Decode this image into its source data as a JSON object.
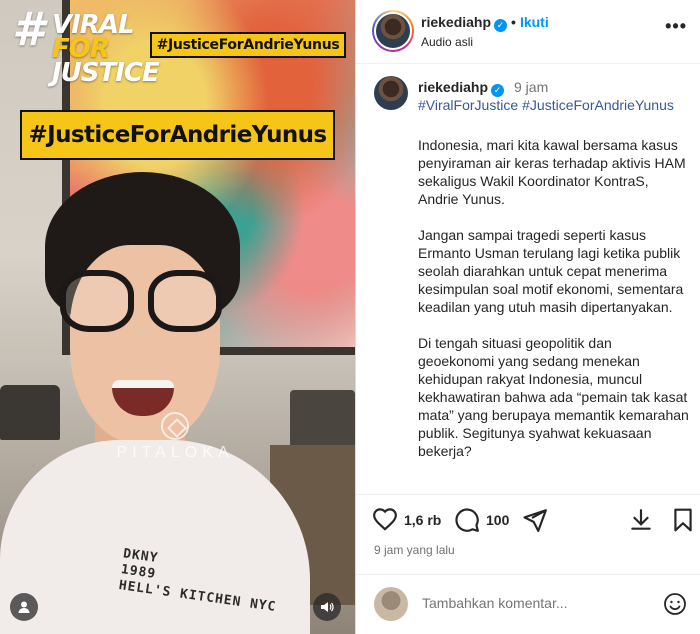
{
  "video": {
    "viral_tag": [
      "#",
      "VIRAL",
      "FOR",
      "JUSTICE"
    ],
    "badge_small": "#JusticeForAndrieYunus",
    "badge_big": "#JusticeForAndrieYunus",
    "watermark": "PITALOKA",
    "shirt_lines": [
      "DKNY",
      "1989",
      "HELL'S KITCHEN NYC"
    ]
  },
  "header": {
    "username": "riekediahp",
    "verified_mark": "✓",
    "separator": "•",
    "follow_label": "Ikuti",
    "audio_label": "Audio asli",
    "more_label": "•••"
  },
  "caption": {
    "username": "riekediahp",
    "time": "9 jam",
    "hashtags": [
      "#ViralForJustice",
      "#JusticeForAndrieYunus"
    ],
    "paragraphs": [
      "Indonesia, mari kita kawal bersama kasus penyiraman air keras terhadap aktivis HAM sekaligus Wakil Koordinator KontraS, Andrie Yunus.",
      "Jangan sampai tragedi seperti kasus Ermanto Usman terulang lagi ketika publik seolah diarahkan untuk cepat menerima kesimpulan soal motif ekonomi, sementara keadilan yang utuh masih dipertanyakan.",
      "Di tengah situasi geopolitik dan geoekonomi yang sedang menekan kehidupan rakyat Indonesia, muncul kekhawatiran bahwa ada “pemain tak kasat mata” yang berupaya memantik kemarahan publik. Segitunya syahwat kekuasaan bekerja?"
    ]
  },
  "actions": {
    "likes": "1,6 rb",
    "comments": "100",
    "time_ago": "9 jam yang lalu"
  },
  "comment_bar": {
    "placeholder": "Tambahkan komentar..."
  }
}
